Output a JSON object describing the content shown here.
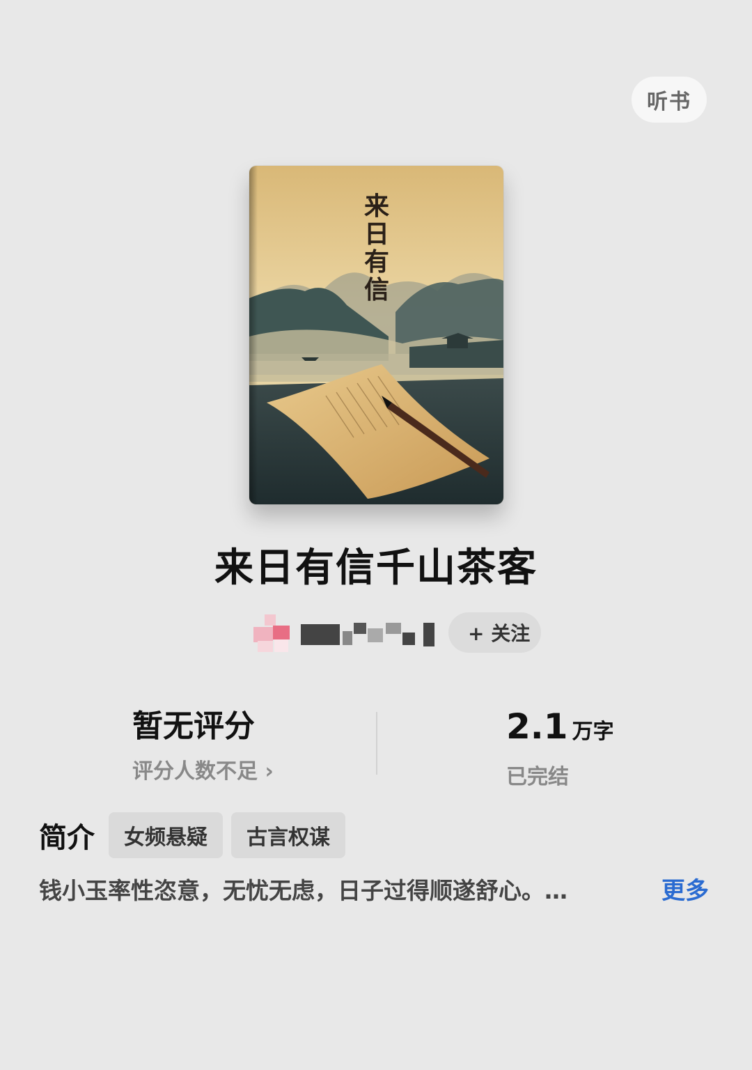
{
  "header": {
    "listen_label": "听书"
  },
  "book": {
    "cover_title": "来日有信",
    "cover_chars": [
      "来",
      "日",
      "有",
      "信"
    ],
    "title": "来日有信千山茶客"
  },
  "author": {
    "follow_label": "+ 关注"
  },
  "stats": {
    "rating_main": "暂无评分",
    "rating_sub": "评分人数不足",
    "rating_chevron": "›",
    "word_count_value": "2.1",
    "word_count_unit": "万字",
    "status": "已完结"
  },
  "intro": {
    "label": "简介",
    "tags": [
      "女频悬疑",
      "古言权谋"
    ],
    "summary": "钱小玉率性恣意，无忧无虑，日子过得顺遂舒心。…",
    "more_label": "更多"
  },
  "colors": {
    "accent_link": "#2a6bd1",
    "background": "#e8e8e8"
  }
}
